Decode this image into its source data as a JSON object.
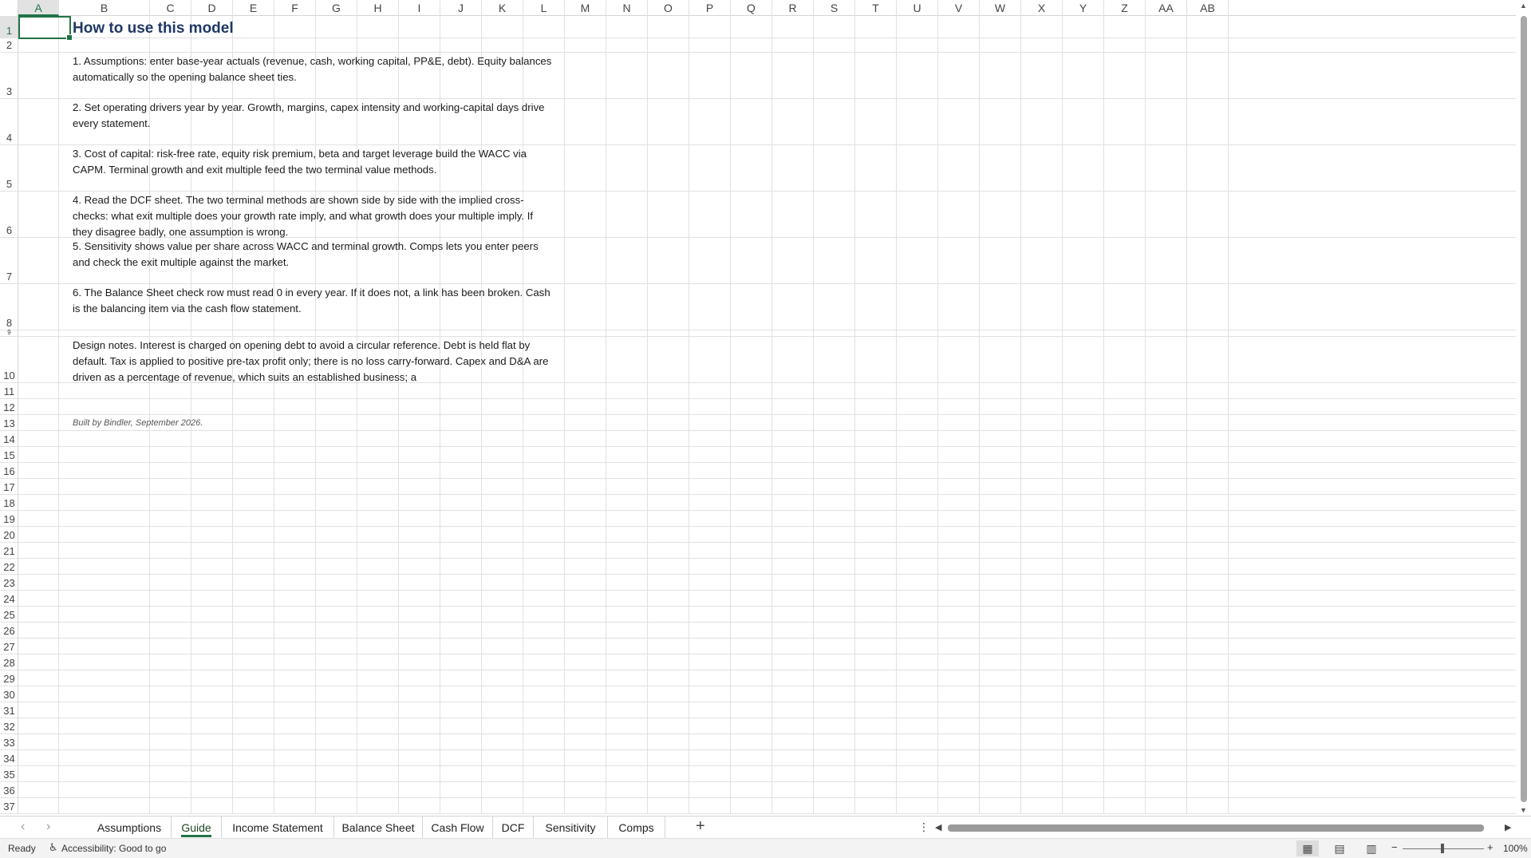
{
  "columns": [
    "A",
    "B",
    "C",
    "D",
    "E",
    "F",
    "G",
    "H",
    "I",
    "J",
    "K",
    "L",
    "M",
    "N",
    "O",
    "P",
    "Q",
    "R",
    "S",
    "T",
    "U",
    "V",
    "W",
    "X",
    "Y",
    "Z",
    "AA",
    "AB"
  ],
  "active_column": "A",
  "rows": [
    "1",
    "2",
    "3",
    "4",
    "5",
    "6",
    "7",
    "8",
    "9",
    "10",
    "11",
    "12",
    "13",
    "14",
    "15",
    "16",
    "17",
    "18",
    "19",
    "20",
    "21",
    "22",
    "23",
    "24",
    "25",
    "26",
    "27",
    "28",
    "29",
    "30",
    "31",
    "32",
    "33",
    "34",
    "35",
    "36",
    "37"
  ],
  "active_row": "1",
  "guide": {
    "title": "How to use this model",
    "steps": [
      "1. Assumptions: enter base-year actuals (revenue, cash, working capital, PP&E, debt). Equity balances automatically so the opening balance sheet ties.",
      "2. Set operating drivers year by year. Growth, margins, capex intensity and working-capital days drive every statement.",
      "3. Cost of capital: risk-free rate, equity risk premium, beta and target leverage build the WACC via CAPM. Terminal growth and exit multiple feed the two terminal value methods.",
      "4. Read the DCF sheet. The two terminal methods are shown side by side with the implied cross-checks: what exit multiple does your growth rate imply, and what growth does your multiple imply. If they disagree badly, one assumption is wrong.",
      "5. Sensitivity shows value per share across WACC and terminal growth. Comps lets you enter peers and check the exit multiple against the market.",
      "6. The Balance Sheet check row must read 0 in every year. If it does not, a link has been broken. Cash is the balancing item via the cash flow statement."
    ],
    "design_notes": "Design notes. Interest is charged on opening debt to avoid a circular reference. Debt is held flat by default. Tax is applied to positive pre-tax profit only; there is no loss carry-forward. Capex and D&A are driven as a percentage of revenue, which suits an established business; a",
    "credit": "Built by Bindler, September 2026."
  },
  "sheet_tabs": [
    {
      "label": "Assumptions",
      "active": false
    },
    {
      "label": "Guide",
      "active": true
    },
    {
      "label": "Income Statement",
      "active": false
    },
    {
      "label": "Balance Sheet",
      "active": false
    },
    {
      "label": "Cash Flow",
      "active": false
    },
    {
      "label": "DCF",
      "active": false
    },
    {
      "label": "Sensitivity",
      "active": false
    },
    {
      "label": "Comps",
      "active": false
    }
  ],
  "status": {
    "ready": "Ready",
    "accessibility": "Accessibility: Good to go",
    "zoom": "100%"
  },
  "colors": {
    "accent": "#217346",
    "title": "#1f3864",
    "gridline": "#e1e1e1"
  },
  "icons": {
    "prev_sheet": "chevron-left-icon",
    "next_sheet": "chevron-right-icon",
    "add_sheet": "plus-icon",
    "more": "vertical-dots-icon",
    "accessibility": "accessibility-person-icon",
    "normal_view": "grid-view-icon",
    "page_layout": "page-layout-icon",
    "page_break": "page-break-icon"
  }
}
